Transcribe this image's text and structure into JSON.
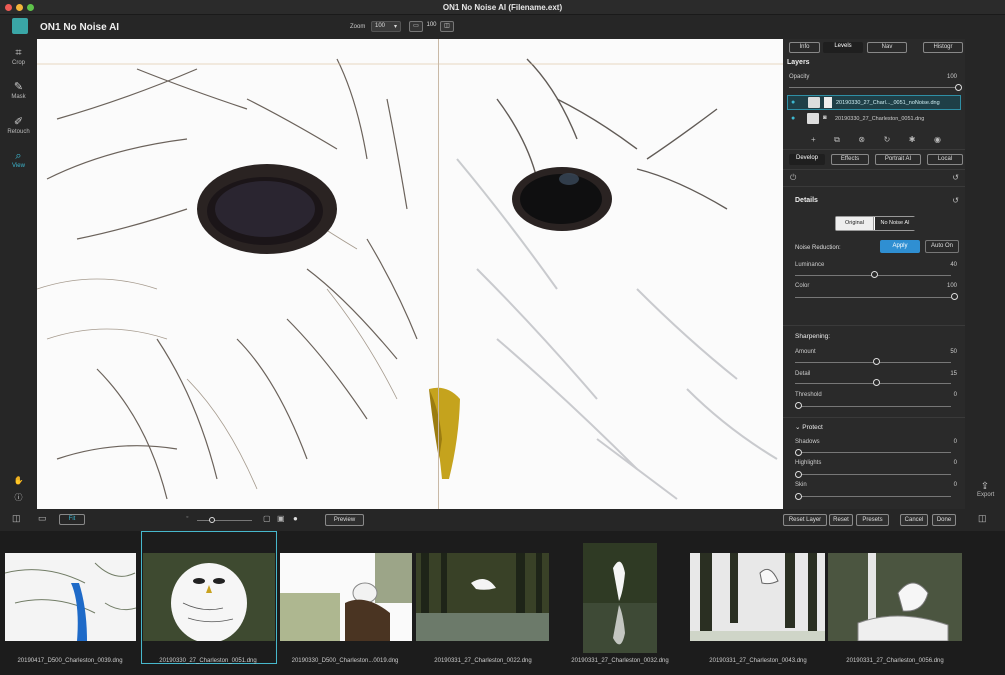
{
  "window": {
    "title": "ON1 No Noise AI (Filename.ext)"
  },
  "app": {
    "name": "ON1 No Noise AI",
    "zoom_label": "Zoom",
    "zoom_value": "100",
    "zoom_100": "100"
  },
  "tools": [
    {
      "label": "Crop",
      "icon": "crop-icon"
    },
    {
      "label": "Mask",
      "icon": "mask-brush-icon"
    },
    {
      "label": "Retouch",
      "icon": "retouch-brush-icon"
    },
    {
      "label": "View",
      "icon": "view-magnifier-icon"
    }
  ],
  "panel": {
    "top_tabs": [
      "Info",
      "Levels",
      "Nav",
      "Histogr"
    ],
    "layers_title": "Layers",
    "opacity_label": "Opacity",
    "opacity_value": "100",
    "layers": [
      "20190330_27_Charl..._0051_noNoise.dng",
      "20190330_27_Charleston_0051.dng"
    ],
    "module_tabs": [
      "Develop",
      "Effects",
      "Portrait AI",
      "Local"
    ],
    "details_title": "Details",
    "detail_toggle": [
      "Original",
      "No Noise AI"
    ],
    "noise_reduction_label": "Noise Reduction:",
    "apply_label": "Apply",
    "autoon_label": "Auto On",
    "luminance": {
      "label": "Luminance",
      "value": "40",
      "level": 0.4
    },
    "color": {
      "label": "Color",
      "value": "100",
      "level": 1.0
    },
    "sharpening_title": "Sharpening:",
    "amount": {
      "label": "Amount",
      "value": "50",
      "level": 0.5
    },
    "detail": {
      "label": "Detail",
      "value": "15",
      "level": 0.5
    },
    "threshold": {
      "label": "Threshold",
      "value": "0",
      "level": 0.0
    },
    "protect_title": "Protect",
    "shadows": {
      "label": "Shadows",
      "value": "0",
      "level": 0.0
    },
    "highlights": {
      "label": "Highlights",
      "value": "0",
      "level": 0.0
    },
    "skin": {
      "label": "Skin",
      "value": "0",
      "level": 0.0
    }
  },
  "bottombar": {
    "preview": "Preview",
    "reset_layer": "Reset Layer",
    "reset": "Reset",
    "presets": "Presets",
    "cancel": "Cancel",
    "done": "Done",
    "zoom_fit": "Fit"
  },
  "dock": {
    "export_label": "Export"
  },
  "filmstrip": [
    "20190417_D500_Charleston_0039.dng",
    "20190330_27_Charleston_0051.dng",
    "20190330_D500_Charleston...0019.dng",
    "20190331_27_Charleston_0022.dng",
    "20190331_27_Charleston_0032.dng",
    "20190331_27_Charleston_0043.dng",
    "20190331_27_Charleston_0056.dng"
  ]
}
